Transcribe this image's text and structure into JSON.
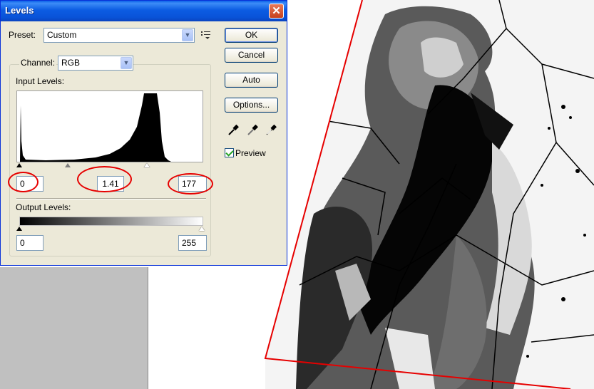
{
  "dialog": {
    "title": "Levels",
    "close_glyph": "✕",
    "preset_label": "Preset:",
    "preset_value": "Custom",
    "preset_menu_icon": "preset-options-icon",
    "channel_label": "Channel:",
    "channel_value": "RGB",
    "input_levels_label": "Input Levels:",
    "input_black": "0",
    "input_gamma": "1.41",
    "input_white": "177",
    "output_levels_label": "Output Levels:",
    "output_black": "0",
    "output_white": "255",
    "buttons": {
      "ok": "OK",
      "cancel": "Cancel",
      "auto": "Auto",
      "options": "Options..."
    },
    "preview_label": "Preview",
    "preview_checked": true,
    "eyedroppers": [
      "black-eyedropper-icon",
      "gray-eyedropper-icon",
      "white-eyedropper-icon"
    ]
  },
  "histogram": {
    "description_levels": "histogram of image tonal values",
    "input_black_point": 0,
    "input_gamma": 1.41,
    "input_white_point": 177
  },
  "colors": {
    "titlebar": "#0a5fe8",
    "dialog_bg": "#ece9d8",
    "annotation": "#e60000"
  }
}
